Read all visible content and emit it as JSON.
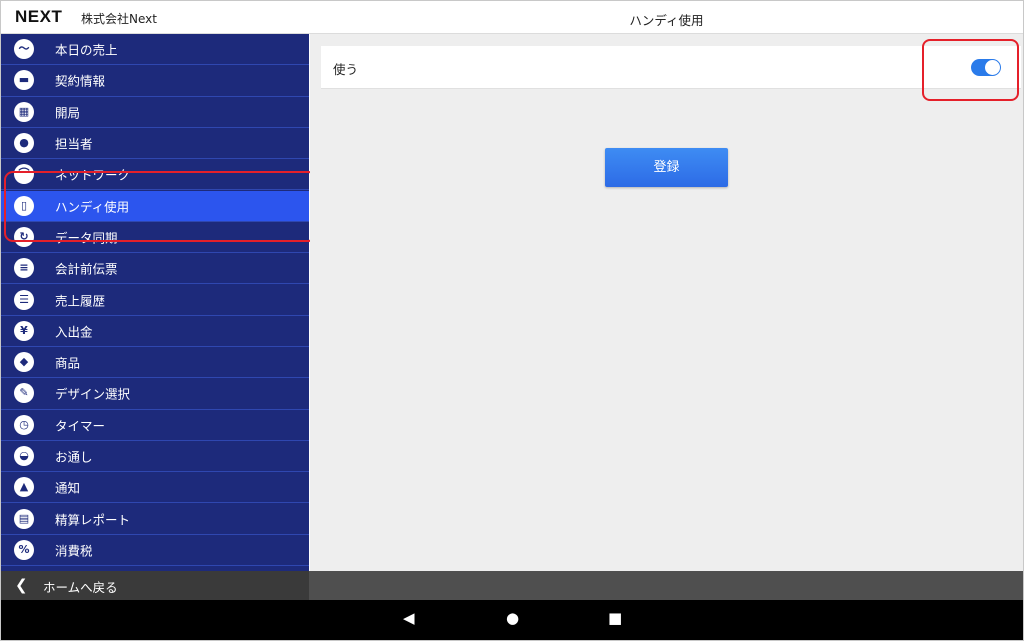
{
  "header": {
    "logo": "NEXT",
    "company": "株式会社Next",
    "title": "ハンディ使用"
  },
  "sidebar": {
    "items": [
      {
        "label": "本日の売上",
        "icon": "chart-line-icon",
        "glyph": "〜"
      },
      {
        "label": "契約情報",
        "icon": "contract-icon",
        "glyph": "▬"
      },
      {
        "label": "開局",
        "icon": "register-icon",
        "glyph": "▦"
      },
      {
        "label": "担当者",
        "icon": "person-icon",
        "glyph": "●"
      },
      {
        "label": "ネットワーク",
        "icon": "wifi-icon",
        "glyph": "⌒"
      },
      {
        "label": "ハンディ使用",
        "icon": "handheld-device-icon",
        "glyph": "▯",
        "active": true
      },
      {
        "label": "データ同期",
        "icon": "sync-icon",
        "glyph": "↻"
      },
      {
        "label": "会計前伝票",
        "icon": "receipt-icon",
        "glyph": "≡"
      },
      {
        "label": "売上履歴",
        "icon": "list-icon",
        "glyph": "☰"
      },
      {
        "label": "入出金",
        "icon": "money-icon",
        "glyph": "¥"
      },
      {
        "label": "商品",
        "icon": "product-icon",
        "glyph": "◆"
      },
      {
        "label": "デザイン選択",
        "icon": "pencil-icon",
        "glyph": "✎"
      },
      {
        "label": "タイマー",
        "icon": "timer-icon",
        "glyph": "◷"
      },
      {
        "label": "お通し",
        "icon": "bowl-icon",
        "glyph": "◒"
      },
      {
        "label": "通知",
        "icon": "bell-icon",
        "glyph": "▲"
      },
      {
        "label": "精算レポート",
        "icon": "report-icon",
        "glyph": "▤"
      },
      {
        "label": "消費税",
        "icon": "percent-icon",
        "glyph": "%"
      }
    ]
  },
  "main": {
    "setting_label": "使う",
    "toggle_on": true,
    "register_label": "登録"
  },
  "footer": {
    "home_label": "ホームへ戻る",
    "home_icon": "chevron-left-icon"
  },
  "android_nav": {
    "back": "◀",
    "home": "●",
    "recents": "■"
  },
  "colors": {
    "sidebar_bg": "#1d2a7b",
    "active_item": "#2c55ee",
    "toggle_on": "#2a7bea",
    "button": "#2d6be6",
    "highlight": "#e5202a"
  }
}
